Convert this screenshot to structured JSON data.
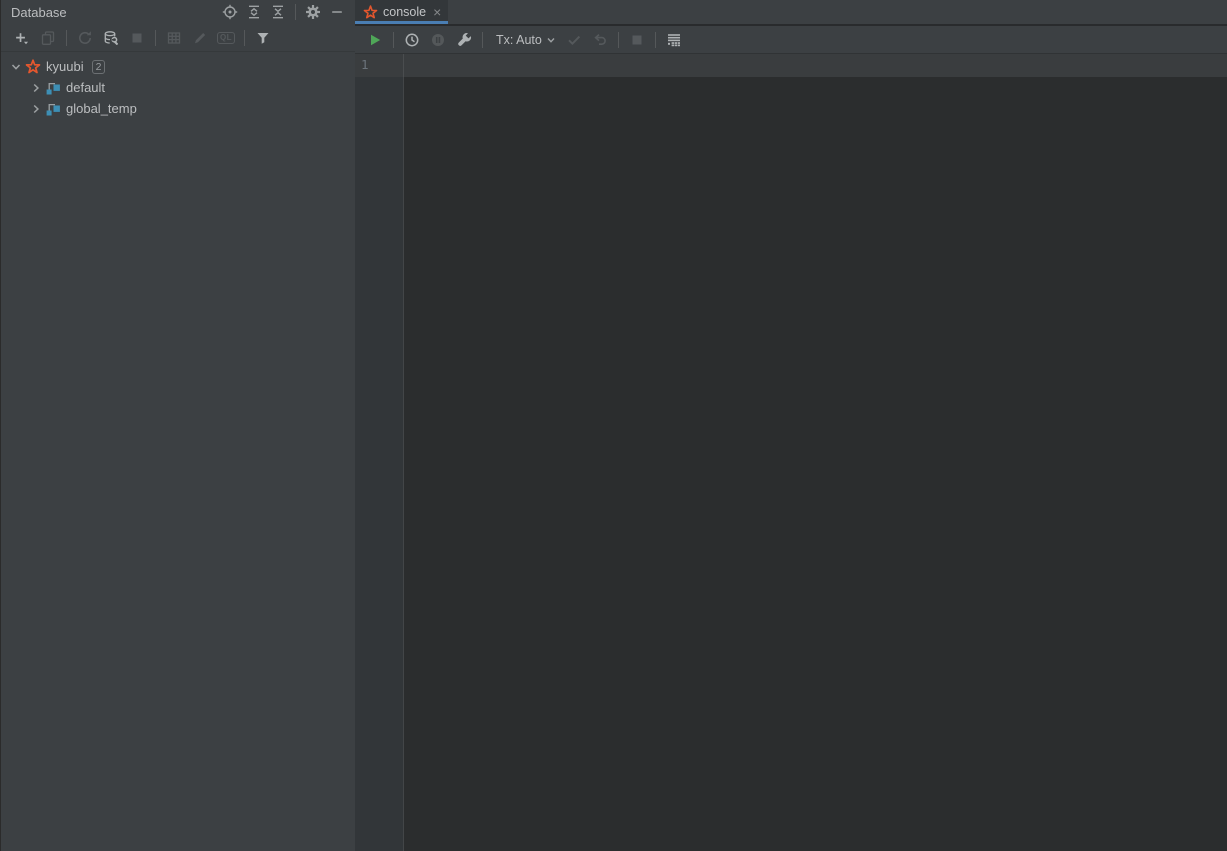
{
  "database_panel": {
    "title": "Database",
    "toolbar": {
      "ql_badge": "QL"
    },
    "tree": {
      "root": {
        "label": "kyuubi",
        "badge": "2"
      },
      "items": [
        {
          "label": "default"
        },
        {
          "label": "global_temp"
        }
      ]
    }
  },
  "console": {
    "tab": {
      "label": "console",
      "close_glyph": "×"
    },
    "toolbar": {
      "tx_label": "Tx: Auto"
    },
    "editor": {
      "line_number": "1"
    }
  },
  "icons": {
    "header": [
      "locate-icon",
      "expand-all-icon",
      "collapse-all-icon",
      "gear-icon",
      "hide-panel-icon"
    ],
    "db_toolbar": [
      "add-icon",
      "duplicate-icon",
      "refresh-icon",
      "datasource-properties-icon",
      "stop-icon",
      "table-icon",
      "edit-icon",
      "ql-console-icon",
      "filter-icon"
    ],
    "run_toolbar": [
      "run-icon",
      "history-clock-icon",
      "pause-icon",
      "wrench-icon",
      "tx-dropdown",
      "commit-check-icon",
      "rollback-icon",
      "stop-icon",
      "output-options-icon"
    ]
  },
  "colors": {
    "panel_bg": "#3C4043",
    "editor_bg": "#2B2D2E",
    "accent_blue": "#4A7EB3",
    "kyuubi_orange": "#E4572E",
    "schema_blue": "#3D8FB5",
    "run_green": "#4FA758"
  }
}
